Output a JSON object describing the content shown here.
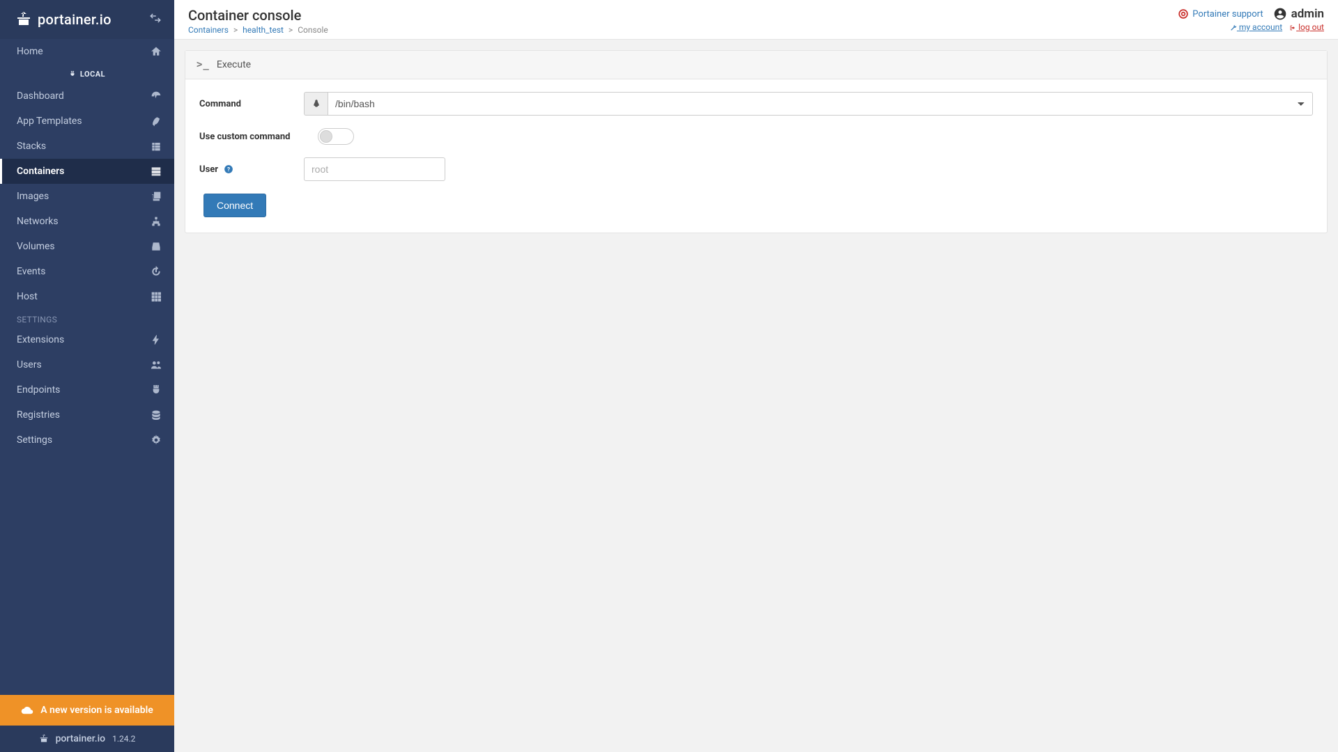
{
  "brand": "portainer.io",
  "sidebar": {
    "home": "Home",
    "endpoint_group": "LOCAL",
    "items": [
      {
        "label": "Dashboard",
        "icon": "dashboard-icon"
      },
      {
        "label": "App Templates",
        "icon": "rocket-icon"
      },
      {
        "label": "Stacks",
        "icon": "list-icon"
      },
      {
        "label": "Containers",
        "icon": "server-icon",
        "active": true
      },
      {
        "label": "Images",
        "icon": "clone-icon"
      },
      {
        "label": "Networks",
        "icon": "sitemap-icon"
      },
      {
        "label": "Volumes",
        "icon": "hdd-icon"
      },
      {
        "label": "Events",
        "icon": "history-icon"
      },
      {
        "label": "Host",
        "icon": "grid-icon"
      }
    ],
    "settings_heading": "SETTINGS",
    "settings_items": [
      {
        "label": "Extensions",
        "icon": "bolt-icon"
      },
      {
        "label": "Users",
        "icon": "users-icon"
      },
      {
        "label": "Endpoints",
        "icon": "plug-icon"
      },
      {
        "label": "Registries",
        "icon": "database-icon"
      },
      {
        "label": "Settings",
        "icon": "cogs-icon"
      }
    ],
    "update_banner": "A new version is available",
    "footer_brand": "portainer.io",
    "version": "1.24.2"
  },
  "header": {
    "title": "Container console",
    "breadcrumb": {
      "containers": "Containers",
      "container_name": "health_test",
      "current": "Console"
    },
    "support_link": "Portainer support",
    "username": "admin",
    "my_account": "my account",
    "log_out": "log out"
  },
  "panel": {
    "title": "Execute"
  },
  "form": {
    "command_label": "Command",
    "command_value": "/bin/bash",
    "custom_command_label": "Use custom command",
    "custom_command_on": false,
    "user_label": "User",
    "user_placeholder": "root",
    "connect_button": "Connect"
  }
}
